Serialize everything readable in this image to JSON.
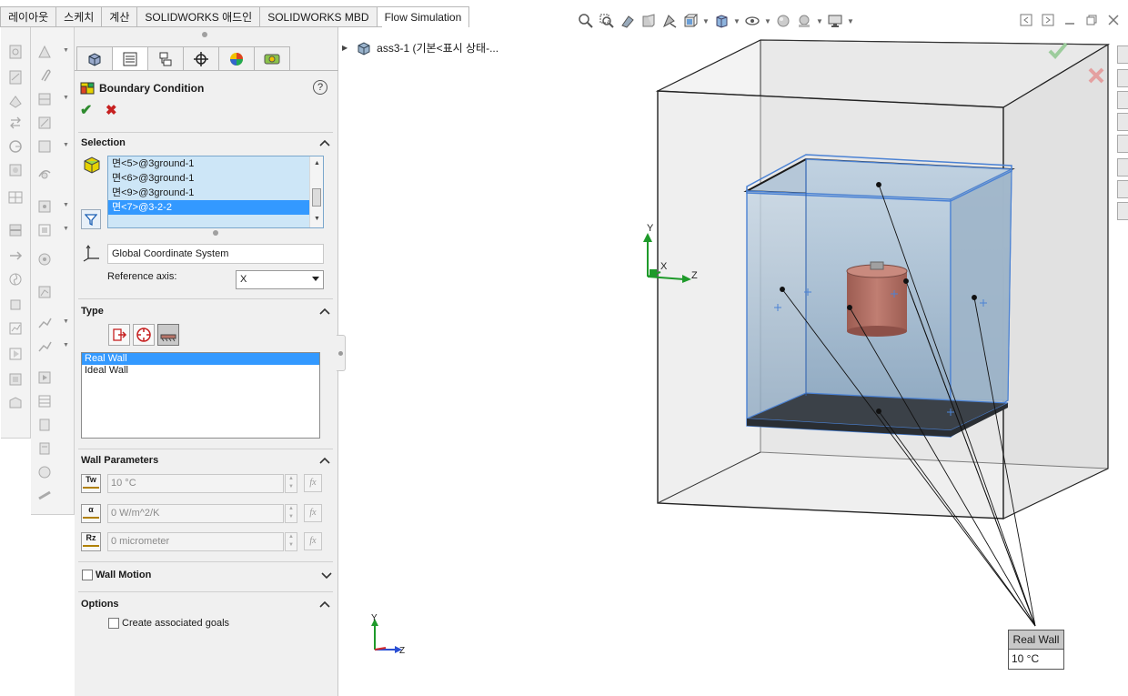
{
  "tabs": [
    "레이아웃",
    "스케치",
    "계산",
    "SOLIDWORKS 애드인",
    "SOLIDWORKS MBD",
    "Flow Simulation"
  ],
  "active_tab": "Flow Simulation",
  "property_manager": {
    "title": "Boundary Condition",
    "help": "?",
    "ok": "✔",
    "cancel": "✖",
    "selection": {
      "header": "Selection",
      "faces": [
        "면<5>@3ground-1",
        "면<6>@3ground-1",
        "면<9>@3ground-1",
        "면<7>@3-2-2"
      ],
      "selected_face": "면<7>@3-2-2",
      "coordinate_system": "Global Coordinate System",
      "reference_axis_label": "Reference axis:",
      "reference_axis_value": "X"
    },
    "type": {
      "header": "Type",
      "options": [
        "Real Wall",
        "Ideal Wall"
      ],
      "selected": "Real Wall"
    },
    "wall_parameters": {
      "header": "Wall Parameters",
      "params": [
        {
          "symbol": "Tw",
          "value": "10 °C"
        },
        {
          "symbol": "α",
          "value": "0 W/m^2/K"
        },
        {
          "symbol": "Rz",
          "value": "0 micrometer"
        }
      ],
      "fx": "fx"
    },
    "wall_motion": {
      "label": "Wall Motion",
      "checked": false
    },
    "options": {
      "header": "Options",
      "create_goals_label": "Create associated goals",
      "create_goals_checked": false
    }
  },
  "feature_tree": {
    "root_label": "ass3-1 (기본<표시 상태-..."
  },
  "viewport": {
    "axis_y": "Y",
    "axis_x": "X",
    "axis_z": "Z",
    "triad_y": "Y",
    "triad_z": "Z",
    "callout_title": "Real Wall",
    "callout_value": "10 °C"
  },
  "colors": {
    "selection_blue": "#3399ff",
    "list_bg": "#cde6f7",
    "ok_green": "#2e8b2e",
    "cancel_red": "#c62020",
    "part_color": "#b87468",
    "fluid_box_blue": "#7fa3c8"
  }
}
